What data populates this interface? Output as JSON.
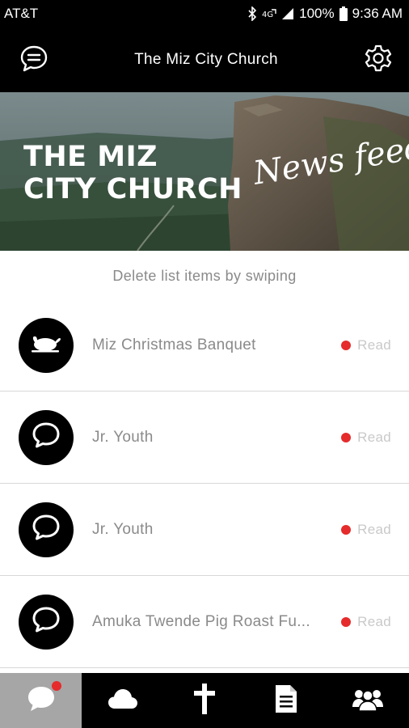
{
  "status_bar": {
    "carrier": "AT&T",
    "battery": "100%",
    "time": "9:36 AM"
  },
  "app_bar": {
    "title": "The Miz City Church"
  },
  "banner": {
    "title_line1": "THE MIZ",
    "title_line2": "CITY CHURCH",
    "script_text": "News feed"
  },
  "hint": "Delete list items by swiping",
  "feed": {
    "items": [
      {
        "title": "Miz Christmas Banquet",
        "icon": "turkey-icon",
        "status": "Read",
        "unread": true
      },
      {
        "title": "Jr. Youth",
        "icon": "chat-bubble-icon",
        "status": "Read",
        "unread": true
      },
      {
        "title": "Jr. Youth",
        "icon": "chat-bubble-icon",
        "status": "Read",
        "unread": true
      },
      {
        "title": "Amuka Twende Pig Roast Fu...",
        "icon": "chat-bubble-icon",
        "status": "Read",
        "unread": true
      }
    ]
  },
  "tabs": [
    {
      "icon": "chat-bubble-icon",
      "active": true,
      "badge": true
    },
    {
      "icon": "cloud-icon",
      "active": false,
      "badge": false
    },
    {
      "icon": "cross-icon",
      "active": false,
      "badge": false
    },
    {
      "icon": "document-icon",
      "active": false,
      "badge": false
    },
    {
      "icon": "group-icon",
      "active": false,
      "badge": false
    }
  ],
  "colors": {
    "bar_background": "#000000",
    "unread_dot": "#e52b2b",
    "active_tab": "#a6a6a6"
  }
}
